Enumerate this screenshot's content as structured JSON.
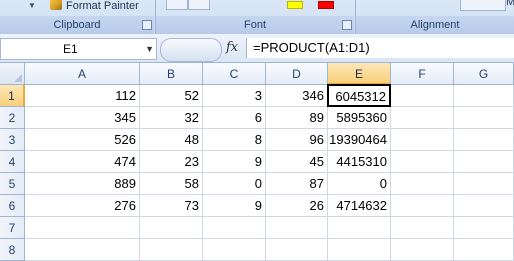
{
  "ribbon": {
    "format_painter": "Format Painter",
    "groups": {
      "clipboard": "Clipboard",
      "font": "Font",
      "alignment": "Alignment"
    }
  },
  "formula_bar": {
    "name_box": "E1",
    "fx": "fx",
    "formula": "=PRODUCT(A1:D1)"
  },
  "sheet": {
    "columns": [
      "A",
      "B",
      "C",
      "D",
      "E",
      "F",
      "G"
    ],
    "rows": [
      "1",
      "2",
      "3",
      "4",
      "5",
      "6",
      "7",
      "8"
    ],
    "cells": [
      [
        "112",
        "52",
        "3",
        "346",
        "6045312",
        "",
        ""
      ],
      [
        "345",
        "32",
        "6",
        "89",
        "5895360",
        "",
        ""
      ],
      [
        "526",
        "48",
        "8",
        "96",
        "19390464",
        "",
        ""
      ],
      [
        "474",
        "23",
        "9",
        "45",
        "4415310",
        "",
        ""
      ],
      [
        "889",
        "58",
        "0",
        "87",
        "0",
        "",
        ""
      ],
      [
        "276",
        "73",
        "9",
        "26",
        "4714632",
        "",
        ""
      ],
      [
        "",
        "",
        "",
        "",
        "",
        "",
        ""
      ],
      [
        "",
        "",
        "",
        "",
        "",
        "",
        ""
      ]
    ],
    "active_cell": "E1"
  }
}
